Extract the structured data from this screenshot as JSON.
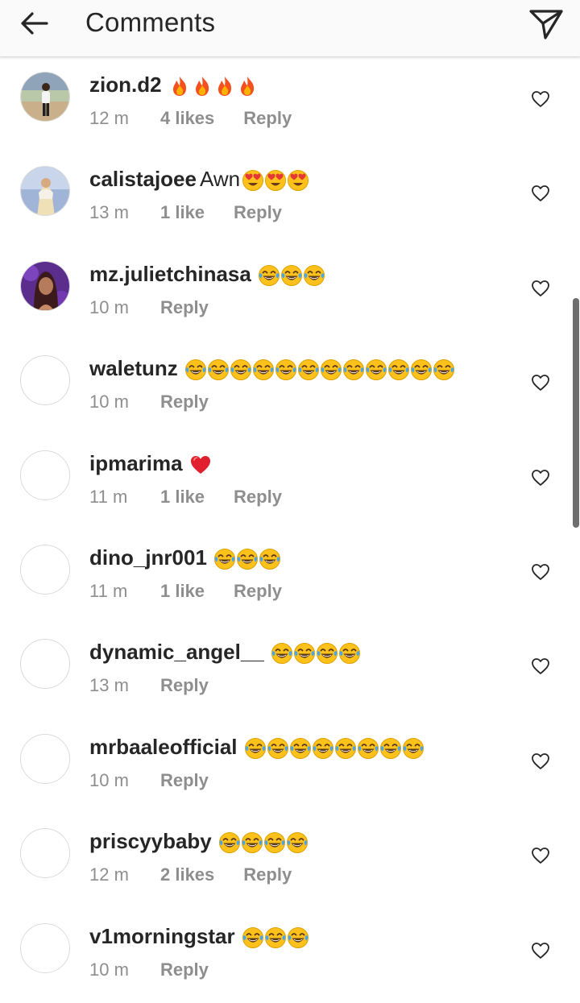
{
  "header": {
    "title": "Comments"
  },
  "icons": {
    "back": "arrow-left-icon",
    "send": "paper-plane-icon",
    "like": "heart-outline-icon"
  },
  "emoji_names": {
    "fire": "🔥",
    "heart_eyes": "😍",
    "joy": "😂",
    "red_heart": "❤️"
  },
  "comments": [
    {
      "username": "zion.d2",
      "text": "",
      "emojis": [
        "fire",
        "fire",
        "fire",
        "fire"
      ],
      "time": "12 m",
      "likes": "4 likes",
      "reply": "Reply",
      "avatar": "photo-person"
    },
    {
      "username": "calistajoee",
      "text": "Awn",
      "emojis": [
        "heart_eyes",
        "heart_eyes",
        "heart_eyes"
      ],
      "time": "13 m",
      "likes": "1 like",
      "reply": "Reply",
      "avatar": "photo-blue"
    },
    {
      "username": "mz.julietchinasa",
      "text": "",
      "emojis": [
        "joy",
        "joy",
        "joy"
      ],
      "time": "10 m",
      "likes": "",
      "reply": "Reply",
      "avatar": "photo-purple"
    },
    {
      "username": "waletunz",
      "text": "",
      "emojis": [
        "joy",
        "joy",
        "joy",
        "joy",
        "joy",
        "joy",
        "joy",
        "joy",
        "joy",
        "joy",
        "joy",
        "joy"
      ],
      "time": "10 m",
      "likes": "",
      "reply": "Reply",
      "avatar": "empty"
    },
    {
      "username": "ipmarima",
      "text": "",
      "emojis": [
        "red_heart"
      ],
      "time": "11 m",
      "likes": "1 like",
      "reply": "Reply",
      "avatar": "empty"
    },
    {
      "username": "dino_jnr001",
      "text": "",
      "emojis": [
        "joy",
        "joy",
        "joy"
      ],
      "time": "11 m",
      "likes": "1 like",
      "reply": "Reply",
      "avatar": "empty"
    },
    {
      "username": "dynamic_angel__",
      "text": "",
      "emojis": [
        "joy",
        "joy",
        "joy",
        "joy"
      ],
      "time": "13 m",
      "likes": "",
      "reply": "Reply",
      "avatar": "empty"
    },
    {
      "username": "mrbaaleofficial",
      "text": "",
      "emojis": [
        "joy",
        "joy",
        "joy",
        "joy",
        "joy",
        "joy",
        "joy",
        "joy"
      ],
      "time": "10 m",
      "likes": "",
      "reply": "Reply",
      "avatar": "empty"
    },
    {
      "username": "priscyybaby",
      "text": "",
      "emojis": [
        "joy",
        "joy",
        "joy",
        "joy"
      ],
      "time": "12 m",
      "likes": "2 likes",
      "reply": "Reply",
      "avatar": "empty"
    },
    {
      "username": "v1morningstar",
      "text": "",
      "emojis": [
        "joy",
        "joy",
        "joy"
      ],
      "time": "10 m",
      "likes": "",
      "reply": "Reply",
      "avatar": "empty"
    }
  ]
}
